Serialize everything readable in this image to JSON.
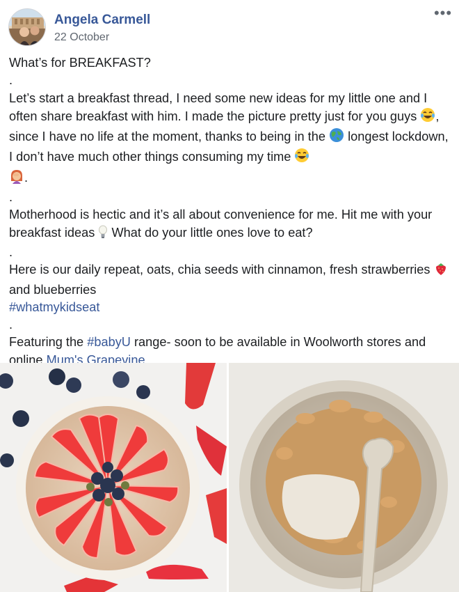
{
  "post": {
    "author": "Angela Carmell",
    "date": "22 October",
    "more_label": "•••",
    "line_title": "What’s for BREAKFAST?",
    "dot": ".",
    "para1_a": "Let’s start a breakfast thread, I need some new ideas for my little one and I often share breakfast with him. I made the picture pretty just for you guys ",
    "para1_b": ", since I have no life at the moment, thanks to being in the ",
    "para1_c": " longest lockdown, I don’t have much other things consuming my time ",
    "para1_d": ".",
    "para2_a": "Motherhood is hectic and it’s all about convenience for me. Hit me with your breakfast ideas ",
    "para2_b": " What do your little ones love to eat?",
    "para3_a": "Here is our daily repeat, oats, chia seeds with cinnamon, fresh strawberries ",
    "para3_b": " and blueberries",
    "hashtag1": "#whatmykidseat",
    "para4_a": "Featuring the ",
    "hashtag2": "#babyU",
    "para4_b": " range- soon to be available in Woolworth stores and online ",
    "page_link": "Mum's Grapevine"
  },
  "emojis": {
    "laugh": "laughing-with-tears-icon",
    "globe": "globe-icon",
    "facepalm": "woman-facepalming-icon",
    "bulb": "light-bulb-icon",
    "strawberry": "strawberry-icon"
  },
  "colors": {
    "link": "#385898",
    "text": "#1c1e21",
    "secondary": "#606770"
  }
}
